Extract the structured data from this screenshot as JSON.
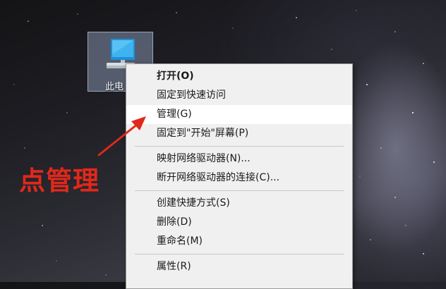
{
  "desktop_icon": {
    "label": "此电"
  },
  "context_menu": {
    "groups": [
      [
        {
          "label": "打开(O)",
          "bold": true
        },
        {
          "label": "固定到快速访问"
        },
        {
          "label": "管理(G)",
          "highlighted": true
        },
        {
          "label": "固定到\"开始\"屏幕(P)"
        }
      ],
      [
        {
          "label": "映射网络驱动器(N)..."
        },
        {
          "label": "断开网络驱动器的连接(C)..."
        }
      ],
      [
        {
          "label": "创建快捷方式(S)"
        },
        {
          "label": "删除(D)"
        },
        {
          "label": "重命名(M)"
        }
      ],
      [
        {
          "label": "属性(R)"
        }
      ]
    ]
  },
  "annotation": {
    "text": "点管理",
    "color": "#e0281b"
  },
  "colors": {
    "menu_bg": "#f0f0f0",
    "menu_highlight": "#ffffff",
    "selection": "#aabee1"
  }
}
